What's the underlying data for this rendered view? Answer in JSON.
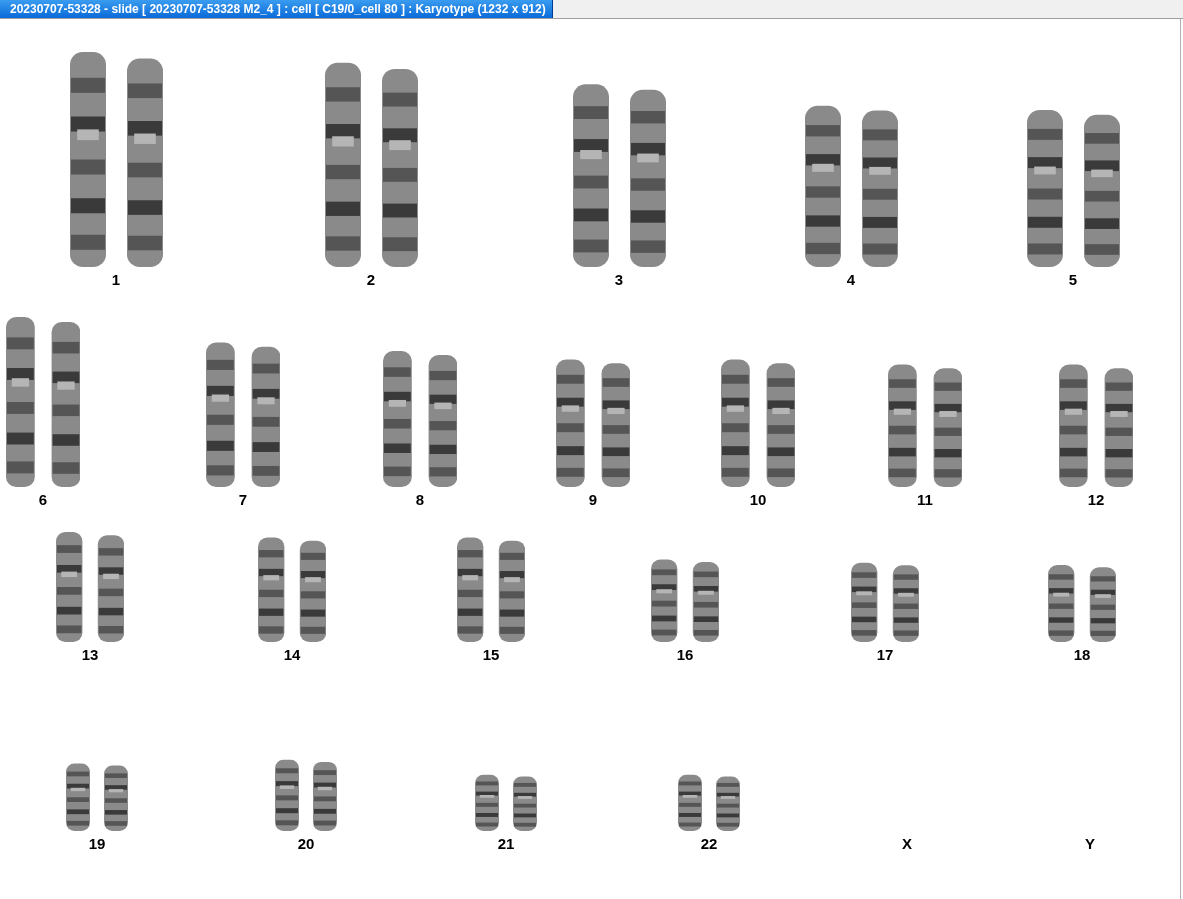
{
  "window": {
    "title": "20230707-53328 - slide [ 20230707-53328 M2_4 ] : cell [ C19/0_cell 80 ] : Karyotype  (1232 x 912)"
  },
  "karyotype": {
    "rows": [
      {
        "slots": [
          {
            "label": "1",
            "kind": "pair"
          },
          {
            "label": "2",
            "kind": "pair"
          },
          {
            "label": "3",
            "kind": "pair"
          },
          {
            "label": "4",
            "kind": "pair"
          },
          {
            "label": "5",
            "kind": "pair"
          }
        ]
      },
      {
        "slots": [
          {
            "label": "6",
            "kind": "pair"
          },
          {
            "label": "7",
            "kind": "pair"
          },
          {
            "label": "8",
            "kind": "pair"
          },
          {
            "label": "9",
            "kind": "pair"
          },
          {
            "label": "10",
            "kind": "pair"
          },
          {
            "label": "11",
            "kind": "pair"
          },
          {
            "label": "12",
            "kind": "pair"
          }
        ]
      },
      {
        "slots": [
          {
            "label": "13",
            "kind": "pair"
          },
          {
            "label": "14",
            "kind": "pair"
          },
          {
            "label": "15",
            "kind": "pair"
          },
          {
            "label": "16",
            "kind": "pair"
          },
          {
            "label": "17",
            "kind": "pair"
          },
          {
            "label": "18",
            "kind": "pair"
          }
        ]
      },
      {
        "slots": [
          {
            "label": "19",
            "kind": "pair"
          },
          {
            "label": "20",
            "kind": "pair"
          },
          {
            "label": "21",
            "kind": "pair"
          },
          {
            "label": "22",
            "kind": "pair"
          },
          {
            "label": "X",
            "kind": "empty"
          },
          {
            "label": "Y",
            "kind": "empty"
          }
        ]
      }
    ]
  }
}
